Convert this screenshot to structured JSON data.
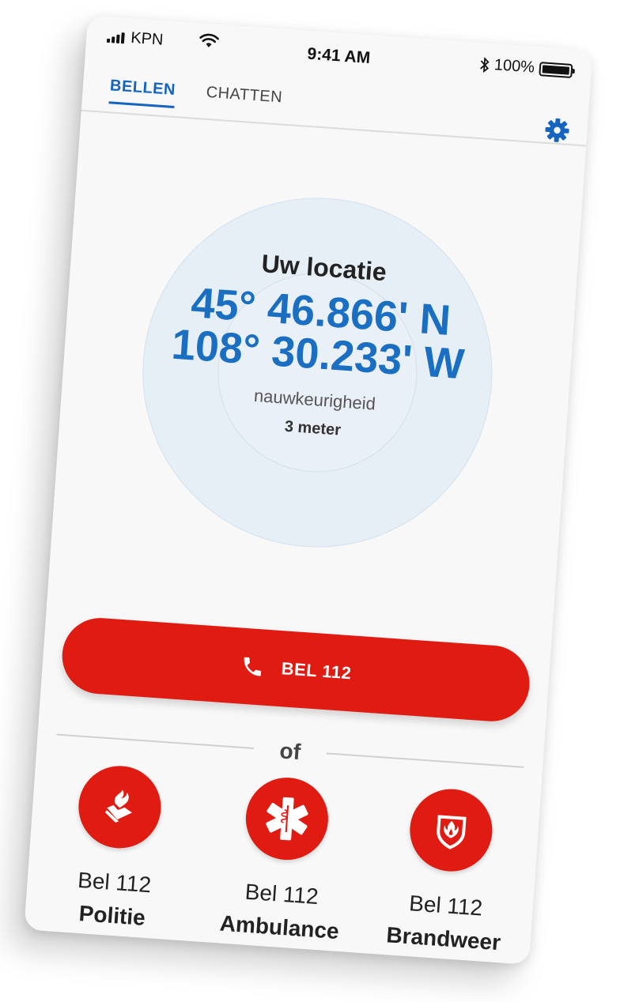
{
  "status_bar": {
    "carrier": "KPN",
    "time": "9:41 AM",
    "battery_percent": "100%",
    "battery_level": 1.0
  },
  "tabs": [
    {
      "label": "BELLEN",
      "active": true
    },
    {
      "label": "CHATTEN",
      "active": false
    }
  ],
  "location": {
    "title": "Uw locatie",
    "latitude": "45° 46.866' N",
    "longitude": "108° 30.233' W",
    "accuracy_label": "nauwkeurigheid",
    "accuracy_value": "3 meter"
  },
  "call_button": {
    "label": "BEL 112"
  },
  "divider_text": "of",
  "services": [
    {
      "line1": "Bel 112",
      "line2": "Politie",
      "icon": "police-icon"
    },
    {
      "line1": "Bel 112",
      "line2": "Ambulance",
      "icon": "star-of-life-icon"
    },
    {
      "line1": "Bel 112",
      "line2": "Brandweer",
      "icon": "fire-department-icon"
    }
  ],
  "colors": {
    "accent_blue": "#1565c0",
    "coordinate_blue": "#1a6fc2",
    "emergency_red": "#e01b12",
    "background": "#f8f8f8"
  }
}
